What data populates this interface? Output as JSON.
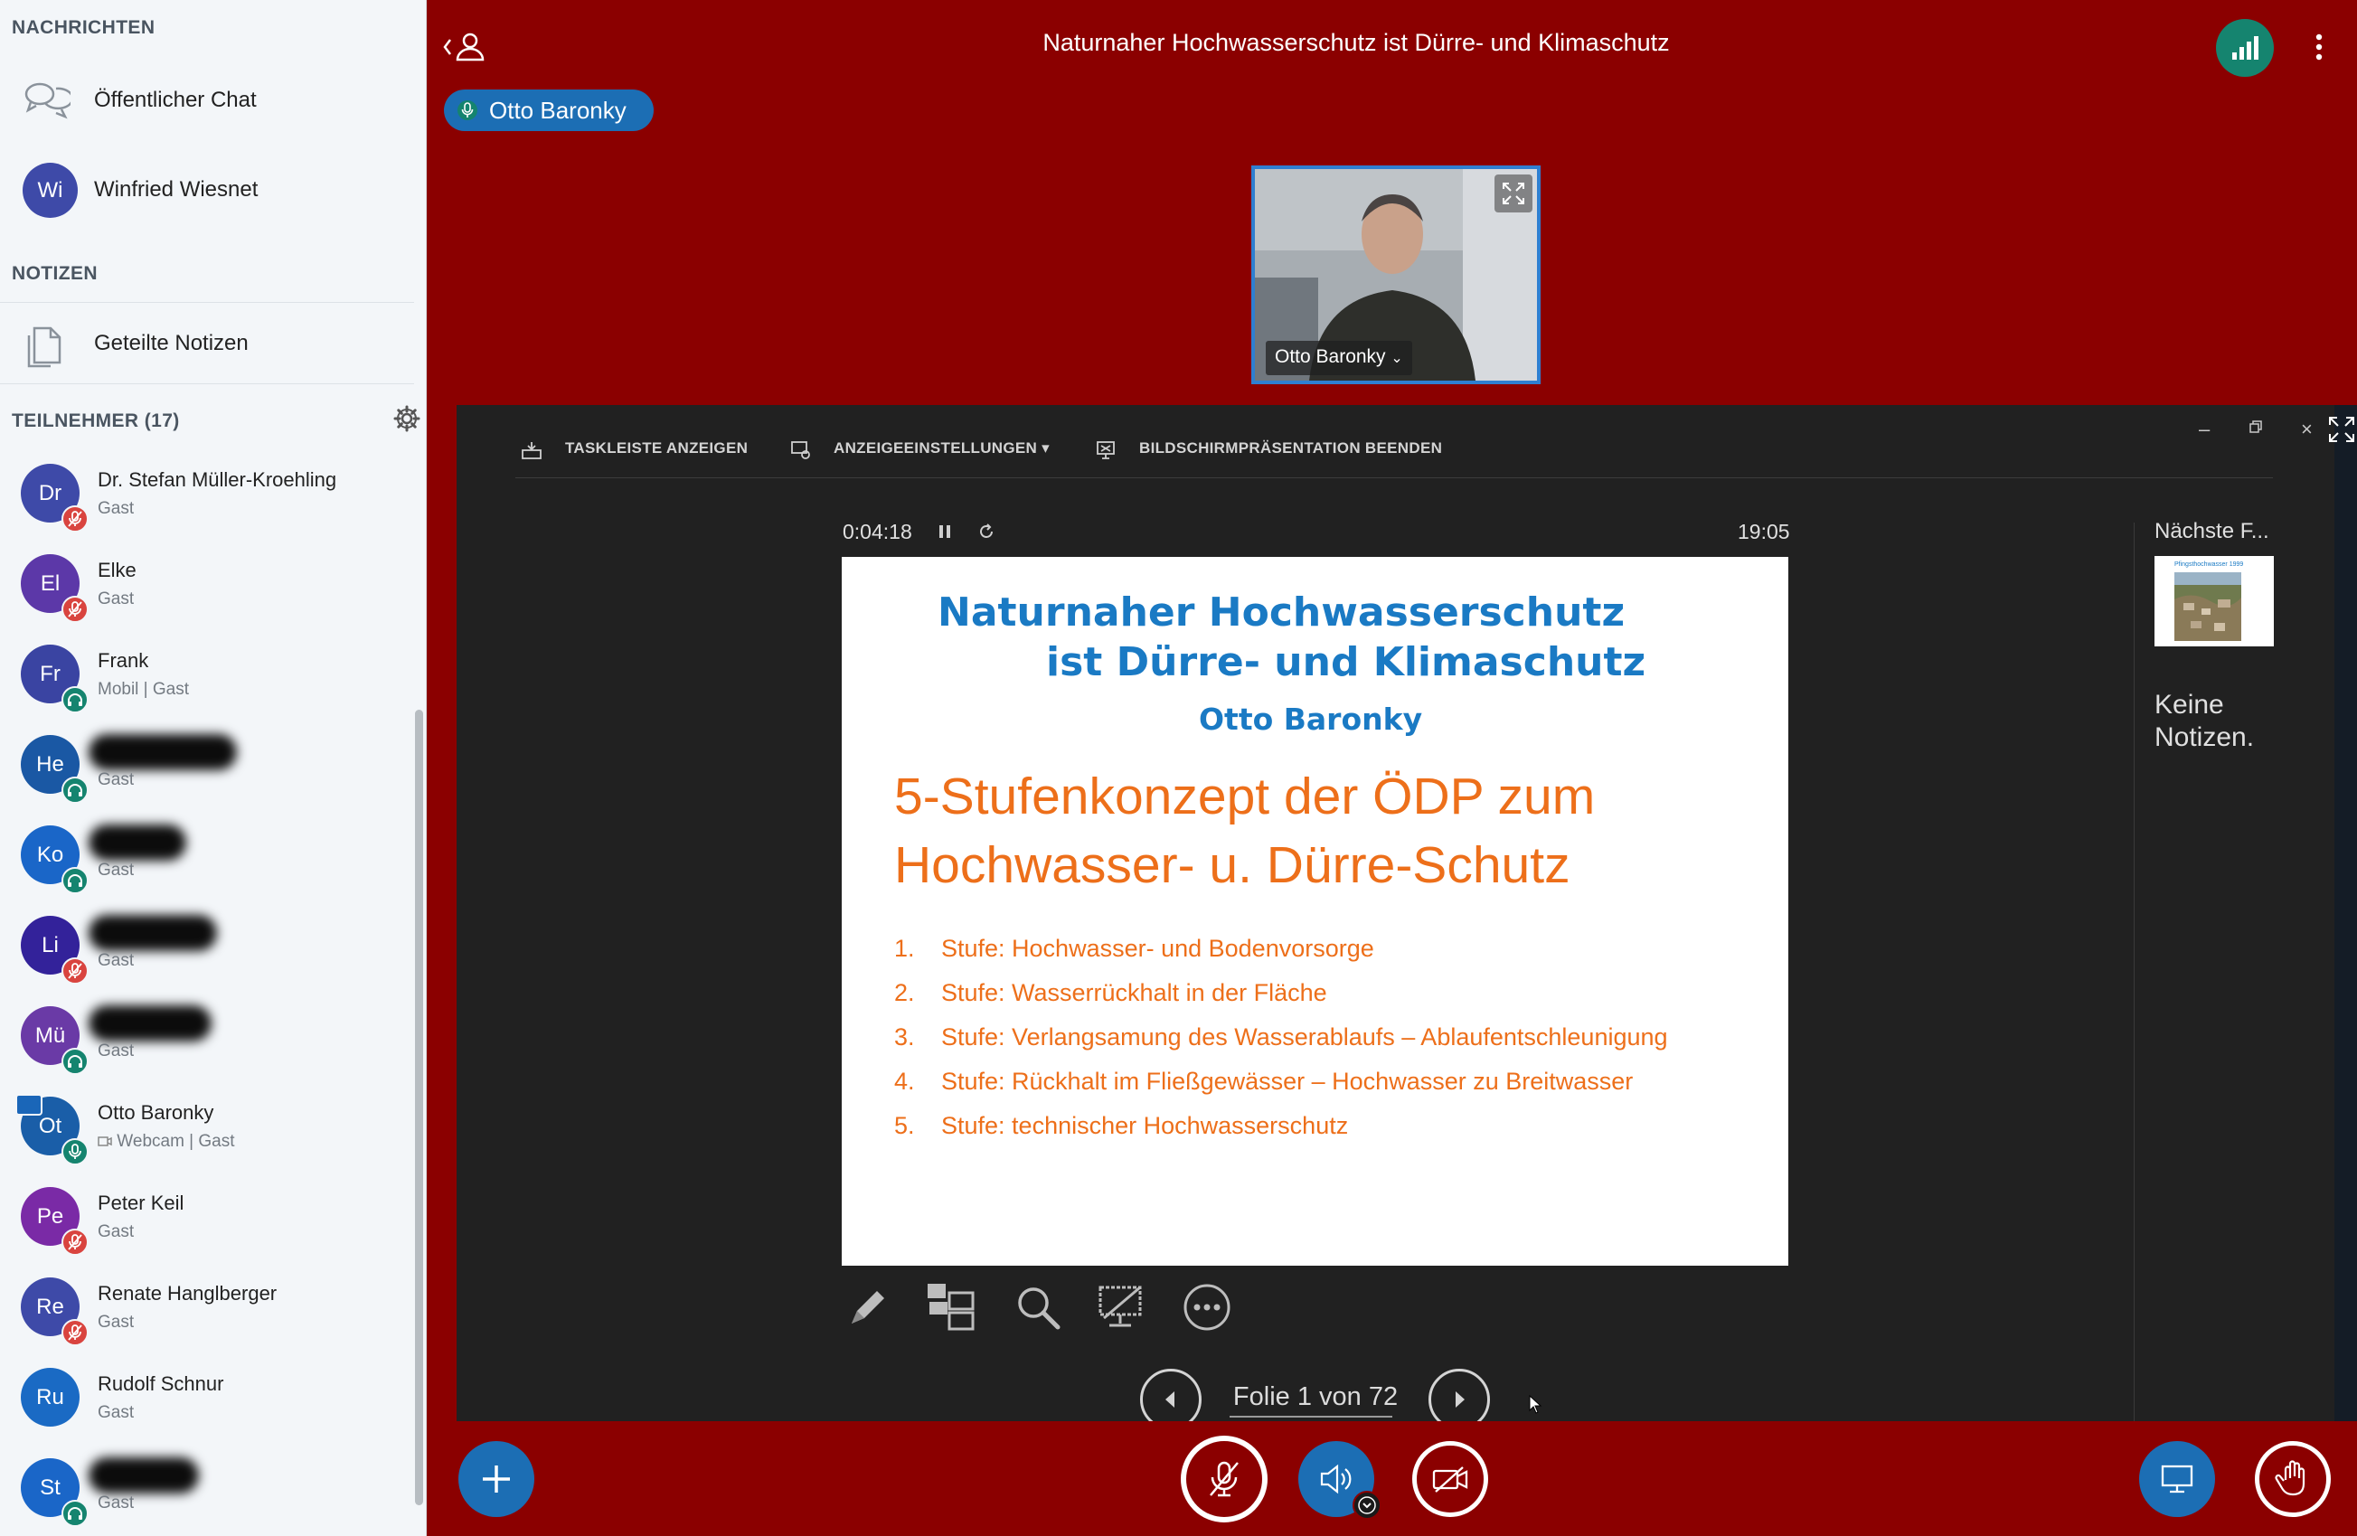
{
  "sidebar": {
    "messages_title": "NACHRICHTEN",
    "public_chat": "Öffentlicher Chat",
    "private_chat": {
      "initials": "Wi",
      "name": "Winfried Wiesnet"
    },
    "notes_title": "NOTIZEN",
    "shared_notes": "Geteilte Notizen",
    "participants_title": "TEILNEHMER (17)",
    "users": [
      {
        "initials": "Dr",
        "name": "Dr. Stefan Müller-Kroehling",
        "sub": "Gast",
        "color": "#3e4aa8",
        "status": "muted"
      },
      {
        "initials": "El",
        "name": "Elke",
        "sub": "Gast",
        "color": "#5c38a8",
        "status": "muted"
      },
      {
        "initials": "Fr",
        "name": "Frank",
        "sub": "Mobil | Gast",
        "color": "#3a44a2",
        "status": "listen"
      },
      {
        "initials": "He",
        "name": "",
        "sub": "Gast",
        "color": "#1a58a4",
        "status": "listen"
      },
      {
        "initials": "Ko",
        "name": "",
        "sub": "Gast",
        "color": "#1a66c8",
        "status": "listen"
      },
      {
        "initials": "Li",
        "name": "",
        "sub": "Gast",
        "color": "#33229a",
        "status": "muted"
      },
      {
        "initials": "Mü",
        "name": "",
        "sub": "Gast",
        "color": "#6a3aa6",
        "status": "listen"
      },
      {
        "initials": "Ot",
        "name": "Otto Baronky",
        "sub": "Webcam | Gast",
        "color": "#1a5ea8",
        "status": "talk"
      },
      {
        "initials": "Pe",
        "name": "Peter Keil",
        "sub": "Gast",
        "color": "#7a2aa6",
        "status": "muted"
      },
      {
        "initials": "Re",
        "name": "Renate Hanglberger",
        "sub": "Gast",
        "color": "#3e4aa8",
        "status": "muted"
      },
      {
        "initials": "Ru",
        "name": "Rudolf Schnur",
        "sub": "Gast",
        "color": "#1a6ac4",
        "status": "none"
      },
      {
        "initials": "St",
        "name": "",
        "sub": "Gast",
        "color": "#1a66c8",
        "status": "listen"
      }
    ]
  },
  "topbar": {
    "title": "Naturnaher Hochwasserschutz ist Dürre- und Klimaschutz",
    "talker": "Otto Baronky"
  },
  "webcam": {
    "label": "Otto Baronky"
  },
  "presenter": {
    "toolbar": {
      "taskbar": "TASKLEISTE ANZEIGEN",
      "display": "ANZEIGEEINSTELLUNGEN ▾",
      "end": "BILDSCHIRMPRÄSENTATION BEENDEN"
    },
    "timer": "0:04:18",
    "clock": "19:05",
    "next_label": "Nächste F...",
    "notes": "Keine Notizen.",
    "slide_count": "Folie 1 von 72",
    "thumb_title": "Pfingsthochwasser 1999"
  },
  "slide": {
    "title_line1": "Naturnaher Hochwasserschutz",
    "title_line2": "ist Dürre- und Klimaschutz",
    "author": "Otto Baronky",
    "heading_line1": "5-Stufenkonzept der ÖDP zum",
    "heading_line2": "Hochwasser- u. Dürre-Schutz",
    "items": [
      {
        "num": "1.",
        "text": "Stufe: Hochwasser- und Bodenvorsorge"
      },
      {
        "num": "2.",
        "text": "Stufe: Wasserrückhalt in der Fläche"
      },
      {
        "num": "3.",
        "text": "Stufe: Verlangsamung des Wasserablaufs – Ablaufentschleunigung"
      },
      {
        "num": "4.",
        "text": "Stufe: Rückhalt im Fließgewässer – Hochwasser zu Breitwasser"
      },
      {
        "num": "5.",
        "text": "Stufe: technischer Hochwasserschutz"
      }
    ]
  },
  "colors": {
    "background": "#8b0000",
    "primary": "#1c6eb4",
    "slide_title": "#1a7ac4",
    "slide_orange": "#ed6f1a",
    "connection": "#15846f"
  }
}
